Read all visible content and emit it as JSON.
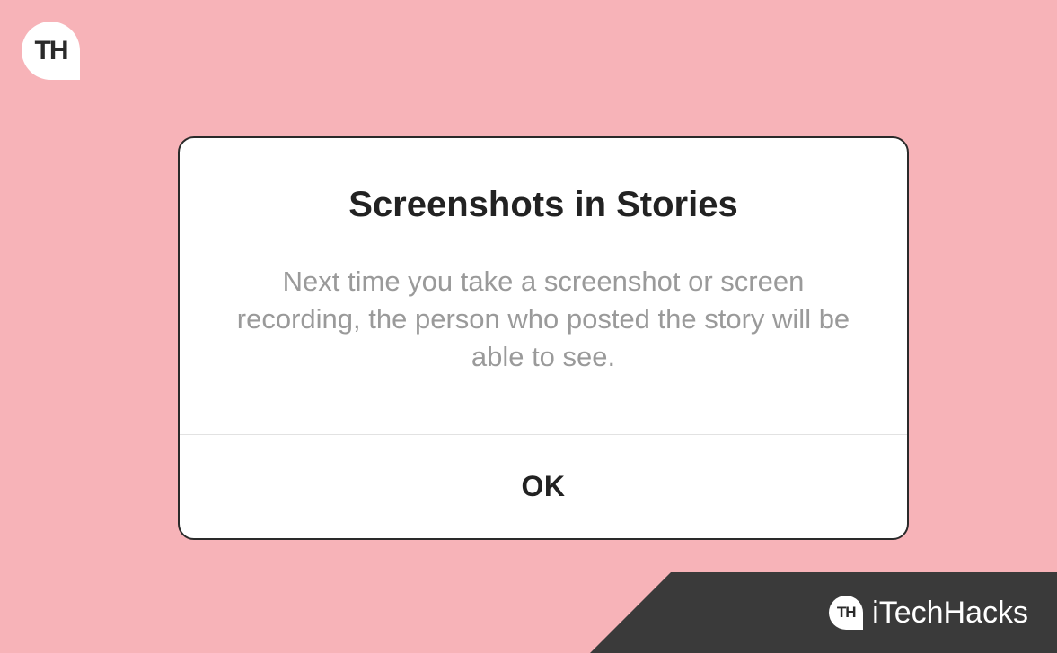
{
  "logo": {
    "text": "TH"
  },
  "dialog": {
    "title": "Screenshots in Stories",
    "message": "Next time you take a screenshot or screen recording, the person who posted the story will be able to see.",
    "ok_label": "OK"
  },
  "watermark": {
    "badge_text": "TH",
    "brand": "iTechHacks"
  }
}
